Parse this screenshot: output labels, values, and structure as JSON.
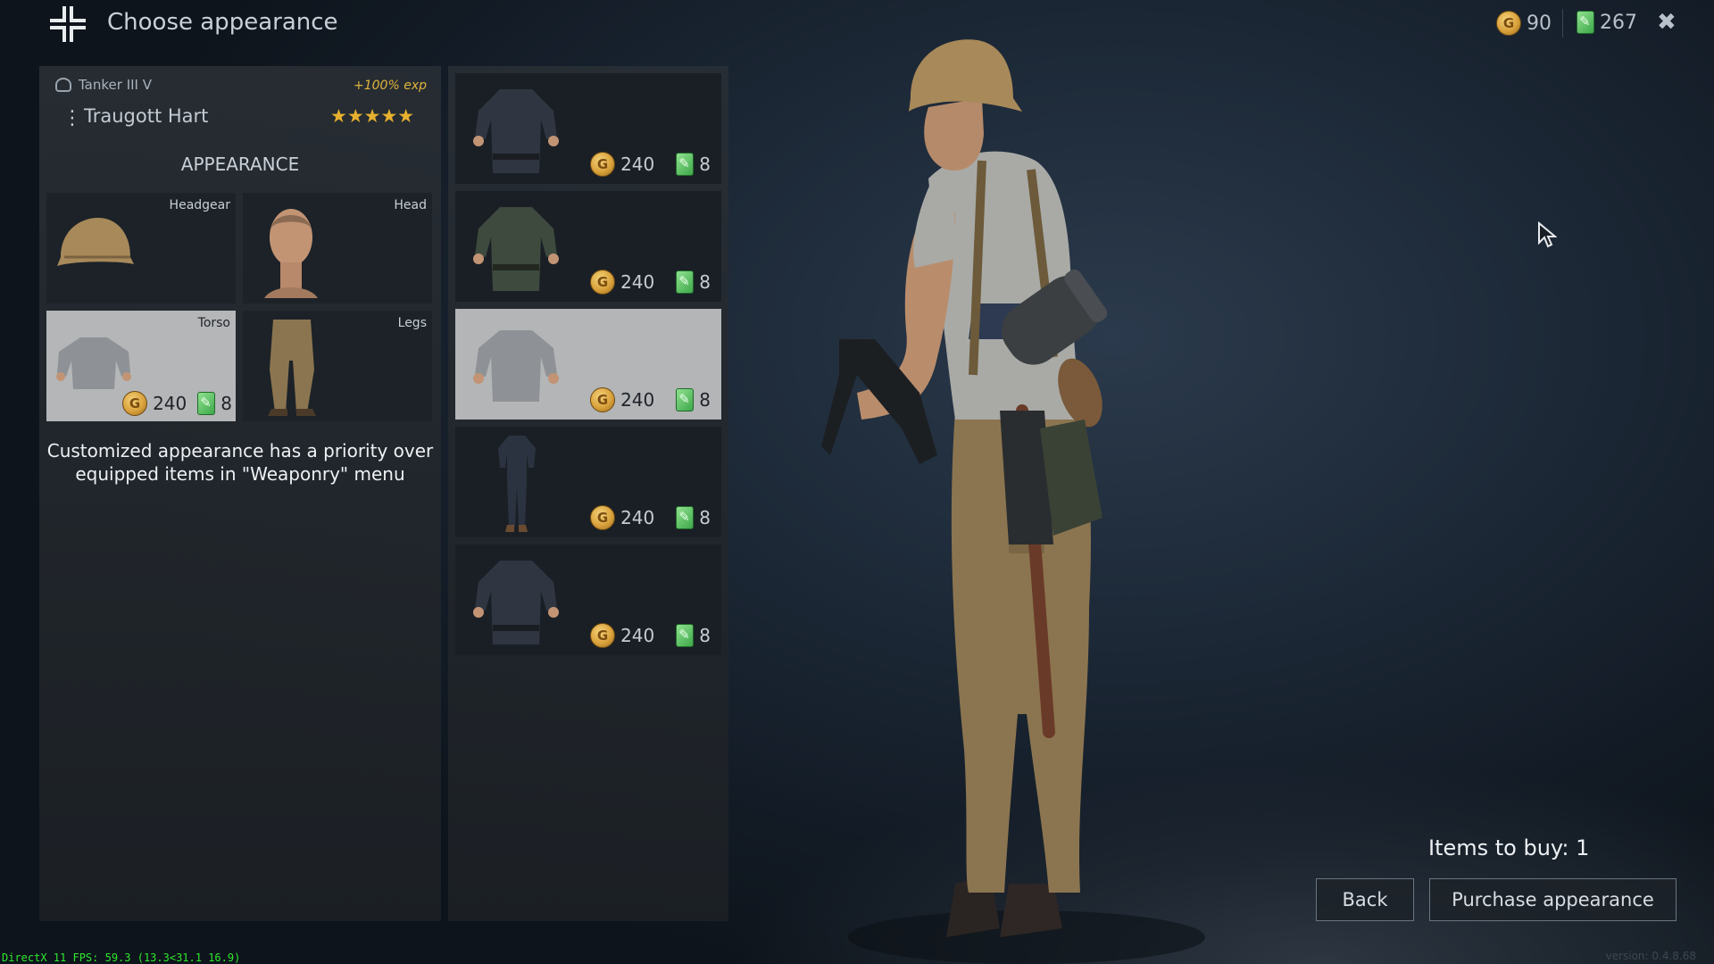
{
  "header": {
    "title": "Choose appearance",
    "gold": "90",
    "tickets": "267"
  },
  "soldier": {
    "class": "Tanker III V",
    "exp_bonus": "+100% exp",
    "name": "Traugott Hart",
    "rating": "★★★★★"
  },
  "appearance": {
    "title": "APPEARANCE",
    "slots": [
      {
        "label": "Headgear"
      },
      {
        "label": "Head"
      },
      {
        "label": "Torso",
        "gold": "240",
        "tickets": "8"
      },
      {
        "label": "Legs"
      }
    ],
    "note_line1": "Customized appearance has a priority over",
    "note_line2": "equipped items in \"Weaponry\" menu"
  },
  "items": [
    {
      "gold": "240",
      "tickets": "8"
    },
    {
      "gold": "240",
      "tickets": "8"
    },
    {
      "gold": "240",
      "tickets": "8"
    },
    {
      "gold": "240",
      "tickets": "8"
    },
    {
      "gold": "240",
      "tickets": "8"
    }
  ],
  "footer": {
    "items_to_buy": "Items to buy: 1",
    "back": "Back",
    "purchase": "Purchase appearance",
    "debug": "DirectX 11 FPS: 59.3 (13.3<31.1 16.9)",
    "version": "version: 0.4.8.68"
  },
  "icons": [
    "balkenkreuz-logo-icon",
    "gold-coin-icon",
    "ticket-icon",
    "close-icon",
    "tanker-class-icon",
    "menu-dots-icon",
    "mouse-cursor-icon"
  ],
  "colors": {
    "gold": "#e7b02e",
    "ticket_green": "#3ea84a",
    "debug_green": "#2ee82e",
    "selected_card": "#b3b5b7"
  }
}
